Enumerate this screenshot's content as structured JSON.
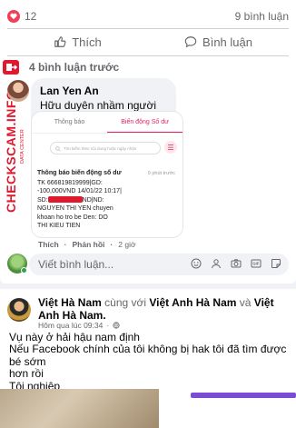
{
  "reactions": {
    "count": "12",
    "comments_count": "9 bình luận"
  },
  "actions": {
    "like_label": "Thích",
    "comment_label": "Bình luận"
  },
  "comments": {
    "prev_label": "4 bình luận trước"
  },
  "comment": {
    "author": "Lan Yen An",
    "text": "Hữu duyên nhầm người chán",
    "like_action": "Thích",
    "reply_action": "Phản hồi",
    "time": "2 giờ"
  },
  "screenshot": {
    "tab_notifications": "Thông báo",
    "tab_balance": "Biến động Số dư",
    "search_placeholder": "Tìm kiếm theo nội dung hoặc ngày nhận",
    "time": "9 phút trước",
    "heading": "Thông báo biến động số dư",
    "line1": "TK 666819819999|GD:",
    "line2": "-100,000VND 14/01/22 10:17|",
    "line3_prefix": "SD:",
    "line3_suffix": "ND|ND:",
    "line4": "NGUYEN THI YEN chuyen",
    "line5": "khoan ho tro be Den: DO",
    "line6": "THI KIEU TIEN"
  },
  "watermark": {
    "text": "CHECKSCAM.INFO",
    "sub": "DATA CENTER"
  },
  "composer": {
    "placeholder": "Viết bình luận..."
  },
  "post": {
    "author": "Việt Hà Nam",
    "with_word": "cùng với",
    "tagged1": "Việt Anh Hà Nam",
    "and_word": "và",
    "tagged2": "Việt Anh Hà Nam.",
    "time": "Hôm qua lúc 09:34",
    "line1": "Vụ này ở hải hậu nam định",
    "line2": "Nếu Facebook chính của tôi không bị hak tôi đã tìm được bé sớm",
    "line3": "hơn rồi",
    "line4": "Tội nghiệp"
  },
  "colors": {
    "brand_red": "#e0192f",
    "heart": "#f33e58",
    "link_blue": "#050505"
  }
}
